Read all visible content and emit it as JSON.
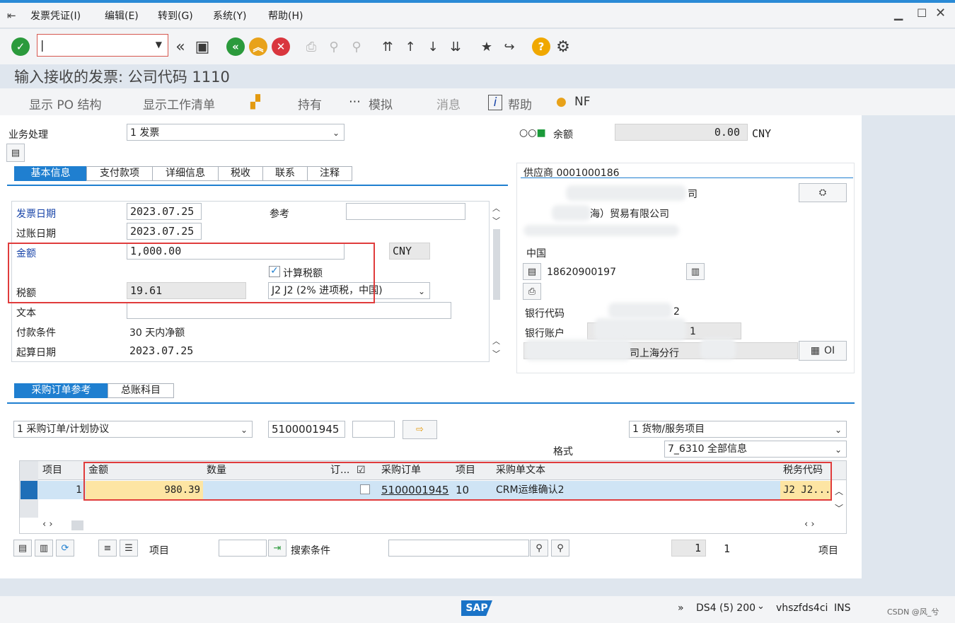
{
  "menu": [
    "发票凭证(I)",
    "编辑(E)",
    "转到(G)",
    "系统(Y)",
    "帮助(H)"
  ],
  "toolbar": {
    "command_value": "",
    "icons": [
      "check-icon",
      "back-icon",
      "save-icon",
      "green-back-icon",
      "exit-icon",
      "cancel-icon",
      "print-icon",
      "find-icon",
      "find-next-icon",
      "first-page-icon",
      "prev-page-icon",
      "next-page-icon",
      "last-page-icon",
      "create-session-icon",
      "shortcut-icon",
      "help-icon",
      "settings-icon"
    ]
  },
  "page_title": "输入接收的发票: 公司代码 1110",
  "appbar": {
    "show_po": "显示 PO 结构",
    "worklist": "显示工作清单",
    "hold": "持有",
    "simulate": "模拟",
    "messages": "消息",
    "help": "帮助",
    "nf": "NF"
  },
  "header": {
    "business_label": "业务处理",
    "business_value": "1 发票",
    "balance_label": "余额",
    "balance_value": "0.00",
    "balance_currency": "CNY"
  },
  "tabs": [
    "基本信息",
    "支付款项",
    "详细信息",
    "税收",
    "联系",
    "注释"
  ],
  "basic": {
    "invoice_date_label": "发票日期",
    "invoice_date": "2023.07.25",
    "reference_label": "参考",
    "reference_value": "",
    "posting_date_label": "过账日期",
    "posting_date": "2023.07.25",
    "amount_label": "金额",
    "amount": "1,000.00",
    "currency": "CNY",
    "calc_tax_label": "计算税额",
    "calc_tax_checked": true,
    "tax_label": "税额",
    "tax_amount": "19.61",
    "tax_code": "J2 J2 (2% 进项税，中国)",
    "text_label": "文本",
    "text_value": "",
    "payment_terms_label": "付款条件",
    "payment_terms": "30 天内净额",
    "baseline_date_label": "起算日期",
    "baseline_date": "2023.07.25"
  },
  "vendor": {
    "title": "供应商 0001000186",
    "name_line1": "司",
    "name_line2": "海）贸易有限公司",
    "country": "中国",
    "phone": "18620900197",
    "bank_code_label": "银行代码",
    "bank_code_value": "2",
    "bank_account_label": "银行账户",
    "bank_account_value": "1",
    "bank_name": "司上海分行",
    "oi_label": "OI"
  },
  "po_tabs": [
    "采购订单参考",
    "总账科目"
  ],
  "po": {
    "ref_type": "1 采购订单/计划协议",
    "po_number": "5100001945",
    "item_field": "",
    "layout_type": "1 货物/服务项目",
    "format_label": "格式",
    "format_value": "7_6310 全部信息"
  },
  "grid": {
    "headers": [
      "项目",
      "金额",
      "数量",
      "订...",
      "",
      "采购订单",
      "项目",
      "采购单文本",
      "税务代码"
    ],
    "row": {
      "item": "1",
      "amount": "980.39",
      "qty": "",
      "ord": "",
      "po": "5100001945",
      "po_item": "10",
      "text": "CRM运维确认2",
      "tax": "J2  J2..."
    }
  },
  "footer": {
    "item_label": "项目",
    "item_value": "",
    "search_label": "搜索条件",
    "search_value": "",
    "page_value": "1",
    "page_total": "1",
    "items_label": "项目"
  },
  "status": {
    "sap": "SAP",
    "system": "DS4 (5) 200",
    "host": "vhszfds4ci",
    "mode": "INS",
    "watermark": "CSDN @风_兮"
  },
  "colors": {
    "accent": "#1f7fd0",
    "highlight_red": "#e03c3c",
    "amount_cell": "#fde5a3",
    "row_selected": "#cfe4f5"
  }
}
